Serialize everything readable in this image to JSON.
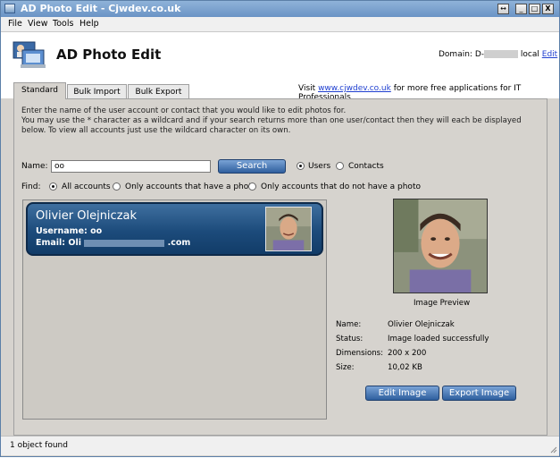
{
  "window": {
    "title": "AD Photo Edit - Cjwdev.co.uk",
    "controls": {
      "maximize_alt": "↔",
      "minimize": "_",
      "restore": "□",
      "close": "X"
    }
  },
  "menu": [
    "File",
    "View",
    "Tools",
    "Help"
  ],
  "header": {
    "app_title": "AD Photo Edit",
    "domain_label": "Domain:",
    "domain_prefix": "D-",
    "domain_suffix": "local",
    "edit_link": "Edit"
  },
  "tabs": [
    "Standard",
    "Bulk Import",
    "Bulk Export"
  ],
  "visit": {
    "prefix": "Visit",
    "link": "www.cjwdev.co.uk",
    "suffix": "for more free applications for IT Professionals"
  },
  "instructions": {
    "line1": "Enter the name of the user account or contact that you would like to edit photos for.",
    "line2": "You may use the * character as a wildcard and if your search returns more than one user/contact then they will each be displayed below. To view all accounts just use the wildcard character on its own."
  },
  "search": {
    "name_label": "Name:",
    "value": "oo",
    "button": "Search",
    "type_options": [
      "Users",
      "Contacts"
    ],
    "type_selected": "Users",
    "find_label": "Find:",
    "find_options": [
      "All accounts",
      "Only accounts that have a photo",
      "Only accounts that do not have a photo"
    ],
    "find_selected": "All accounts"
  },
  "result": {
    "name": "Olivier Olejniczak",
    "username_line": "Username: oo",
    "email_label": "Email: Oli",
    "email_domain": ".com"
  },
  "preview": {
    "label": "Image Preview",
    "details": [
      {
        "label": "Name:",
        "value": "Olivier Olejniczak"
      },
      {
        "label": "Status:",
        "value": "Image loaded successfully"
      },
      {
        "label": "Dimensions:",
        "value": "200 x 200"
      },
      {
        "label": "Size:",
        "value": "10,02 KB"
      }
    ],
    "edit_button": "Edit Image",
    "export_button": "Export Image"
  },
  "status": "1 object found",
  "colors": {
    "accent": "#2f5f9e",
    "link": "#1f3fd0",
    "card": "#1c4b7b"
  }
}
